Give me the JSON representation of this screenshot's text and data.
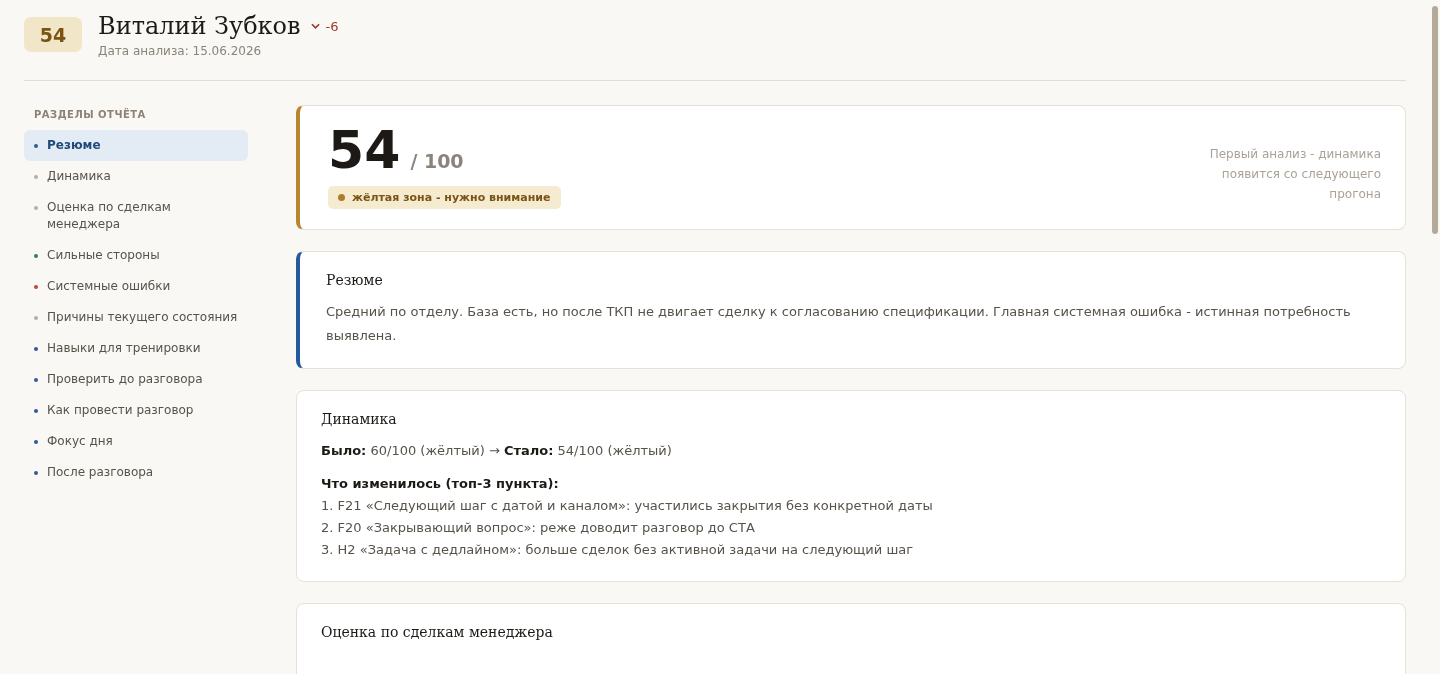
{
  "header": {
    "score_badge": "54",
    "name": "Виталий Зубков",
    "delta": "-6",
    "date": "Дата анализа: 15.06.2026"
  },
  "sidebar": {
    "title": "РАЗДЕЛЫ ОТЧЁТА",
    "items": [
      {
        "label": "Резюме",
        "selected": true,
        "color": "#2e5e94"
      },
      {
        "label": "Динамика",
        "selected": false,
        "color": "#b8ada0"
      },
      {
        "label": "Оценка по сделкам менеджера",
        "selected": false,
        "color": "#b8ada0"
      },
      {
        "label": "Сильные стороны",
        "selected": false,
        "color": "#3a7d4f"
      },
      {
        "label": "Системные ошибки",
        "selected": false,
        "color": "#b84a3a"
      },
      {
        "label": "Причины текущего состояния",
        "selected": false,
        "color": "#b8ada0"
      },
      {
        "label": "Навыки для тренировки",
        "selected": false,
        "color": "#2e5e94"
      },
      {
        "label": "Проверить до разговора",
        "selected": false,
        "color": "#2e5e94"
      },
      {
        "label": "Как провести разговор",
        "selected": false,
        "color": "#2e5e94"
      },
      {
        "label": "Фокус дня",
        "selected": false,
        "color": "#2e5e94"
      },
      {
        "label": "После разговора",
        "selected": false,
        "color": "#2e5e94"
      }
    ]
  },
  "score_card": {
    "score": "54",
    "max": "/ 100",
    "zone": "жёлтая зона - нужно внимание",
    "note": "Первый анализ - динамика появится со следующего прогона"
  },
  "summary": {
    "title": "Резюме",
    "text": "Средний по отделу. База есть, но после ТКП не двигает сделку к согласованию спецификации. Главная системная ошибка - истинная потребность выявлена."
  },
  "dynamics": {
    "title": "Динамика",
    "change": "**Было:** 60/100 (жёлтый) → **Стало:** 54/100 (жёлтый)",
    "subtitle": "Что изменилось (топ-3 пункта):",
    "points": [
      "1. F21 «Следующий шаг с датой и каналом»: участились закрытия без конкретной даты",
      "2. F20 «Закрывающий вопрос»: реже доводит разговор до СТА",
      "3. Н2 «Задача с дедлайном»: больше сделок без активной задачи на следующий шаг"
    ]
  },
  "deals": {
    "title": "Оценка по сделкам менеджера"
  }
}
